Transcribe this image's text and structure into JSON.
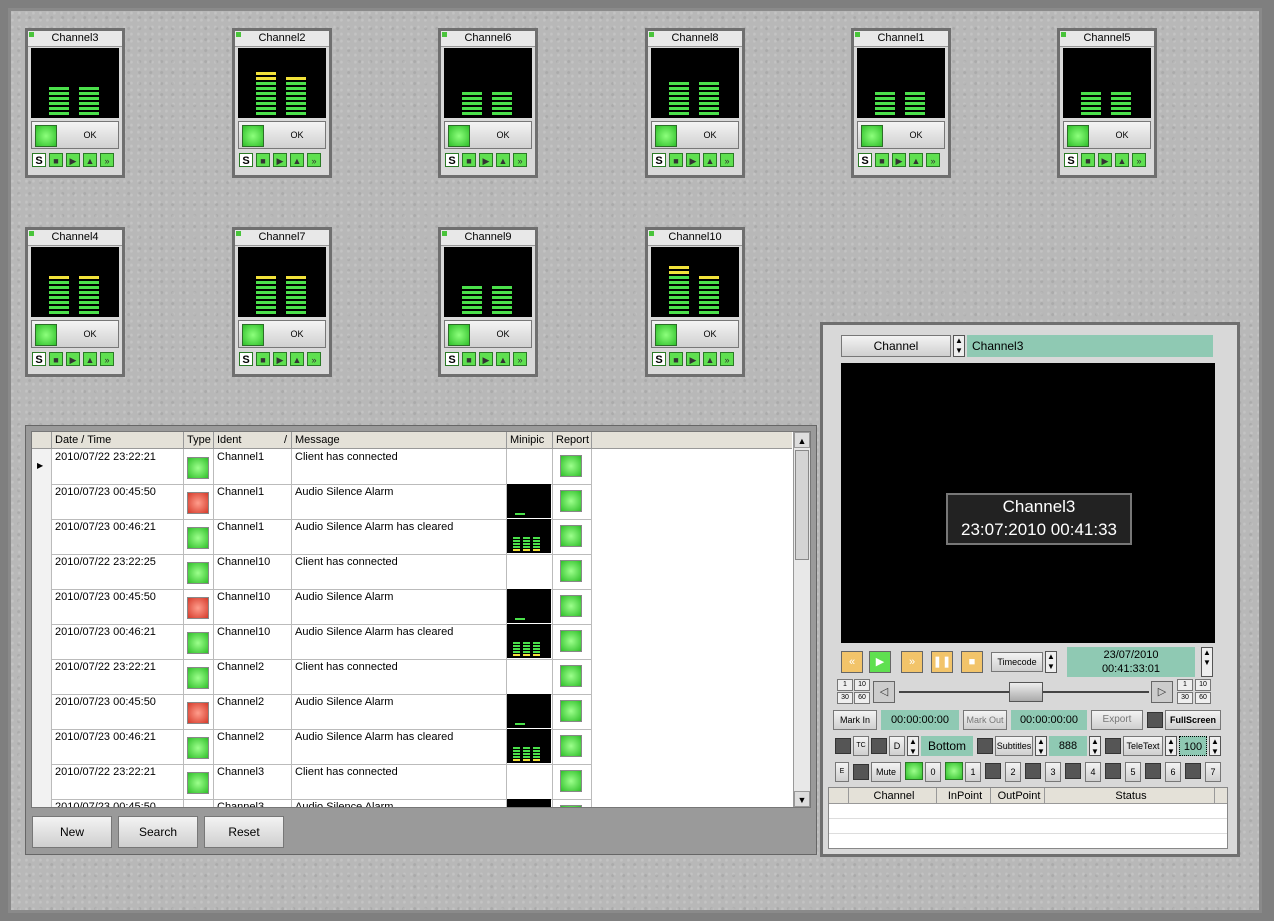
{
  "tiles": [
    {
      "name": "Channel3",
      "status": "OK",
      "levels": [
        6,
        6
      ],
      "yellow": [
        0,
        0
      ]
    },
    {
      "name": "Channel2",
      "status": "OK",
      "levels": [
        9,
        8
      ],
      "yellow": [
        2,
        1
      ]
    },
    {
      "name": "Channel6",
      "status": "OK",
      "levels": [
        5,
        5
      ],
      "yellow": [
        0,
        0
      ]
    },
    {
      "name": "Channel8",
      "status": "OK",
      "levels": [
        7,
        7
      ],
      "yellow": [
        0,
        0
      ]
    },
    {
      "name": "Channel1",
      "status": "OK",
      "levels": [
        5,
        5
      ],
      "yellow": [
        0,
        0
      ]
    },
    {
      "name": "Channel5",
      "status": "OK",
      "levels": [
        5,
        5
      ],
      "yellow": [
        0,
        0
      ]
    },
    {
      "name": "Channel4",
      "status": "OK",
      "levels": [
        8,
        8
      ],
      "yellow": [
        1,
        1
      ]
    },
    {
      "name": "Channel7",
      "status": "OK",
      "levels": [
        8,
        8
      ],
      "yellow": [
        1,
        1
      ]
    },
    {
      "name": "Channel9",
      "status": "OK",
      "levels": [
        6,
        6
      ],
      "yellow": [
        0,
        0
      ]
    },
    {
      "name": "Channel10",
      "status": "OK",
      "levels": [
        10,
        8
      ],
      "yellow": [
        2,
        1
      ]
    }
  ],
  "tile_controls": {
    "solo": "S",
    "stop": "■",
    "play": "▶",
    "eject": "▲",
    "ff": "»"
  },
  "log": {
    "headers": {
      "datetime": "Date / Time",
      "type": "Type",
      "ident": "Ident",
      "sort": "/",
      "message": "Message",
      "minipic": "Minipic",
      "report": "Report"
    },
    "rows": [
      {
        "datetime": "2010/07/22 23:22:21",
        "type": "green",
        "ident": "Channel1",
        "message": "Client has connected",
        "minipic": false
      },
      {
        "datetime": "2010/07/23 00:45:50",
        "type": "red",
        "ident": "Channel1",
        "message": "Audio Silence Alarm",
        "minipic": true
      },
      {
        "datetime": "2010/07/23 00:46:21",
        "type": "green",
        "ident": "Channel1",
        "message": "Audio Silence Alarm has cleared",
        "minipic": true
      },
      {
        "datetime": "2010/07/22 23:22:25",
        "type": "green",
        "ident": "Channel10",
        "message": "Client has connected",
        "minipic": false
      },
      {
        "datetime": "2010/07/23 00:45:50",
        "type": "red",
        "ident": "Channel10",
        "message": "Audio Silence Alarm",
        "minipic": true
      },
      {
        "datetime": "2010/07/23 00:46:21",
        "type": "green",
        "ident": "Channel10",
        "message": "Audio Silence Alarm has cleared",
        "minipic": true
      },
      {
        "datetime": "2010/07/22 23:22:21",
        "type": "green",
        "ident": "Channel2",
        "message": "Client has connected",
        "minipic": false
      },
      {
        "datetime": "2010/07/23 00:45:50",
        "type": "red",
        "ident": "Channel2",
        "message": "Audio Silence Alarm",
        "minipic": true
      },
      {
        "datetime": "2010/07/23 00:46:21",
        "type": "green",
        "ident": "Channel2",
        "message": "Audio Silence Alarm has cleared",
        "minipic": true
      },
      {
        "datetime": "2010/07/22 23:22:21",
        "type": "green",
        "ident": "Channel3",
        "message": "Client has connected",
        "minipic": false
      },
      {
        "datetime": "2010/07/23 00:45:50",
        "type": "red",
        "ident": "Channel3",
        "message": "Audio Silence Alarm",
        "minipic": true
      }
    ],
    "buttons": {
      "new": "New",
      "search": "Search",
      "reset": "Reset"
    }
  },
  "player": {
    "channel_label": "Channel",
    "channel_value": "Channel3",
    "overlay_line1": "Channel3",
    "overlay_line2": "23:07:2010 00:41:33",
    "timecode_label": "Timecode",
    "tc_date": "23/07/2010",
    "tc_time": "00:41:33:01",
    "speed_left": [
      "1",
      "10",
      "30",
      "60"
    ],
    "speed_right": [
      "1",
      "10",
      "30",
      "60"
    ],
    "mark_in_label": "Mark In",
    "mark_in_value": "00:00:00:00",
    "mark_out_label": "Mark Out",
    "mark_out_value": "00:00:00:00",
    "export_label": "Export",
    "fullscreen_label": "FullScreen",
    "tc_toggle": "TC",
    "d_toggle": "D",
    "position_value": "Bottom",
    "subtitles_label": "Subtitles",
    "subtitles_value": "888",
    "teletext_label": "TeleText",
    "teletext_value": "100",
    "e_label": "E",
    "mute_label": "Mute",
    "numbers": [
      "0",
      "1",
      "2",
      "3",
      "4",
      "5",
      "6",
      "7"
    ],
    "table_headers": {
      "channel": "Channel",
      "inpoint": "InPoint",
      "outpoint": "OutPoint",
      "status": "Status"
    }
  }
}
